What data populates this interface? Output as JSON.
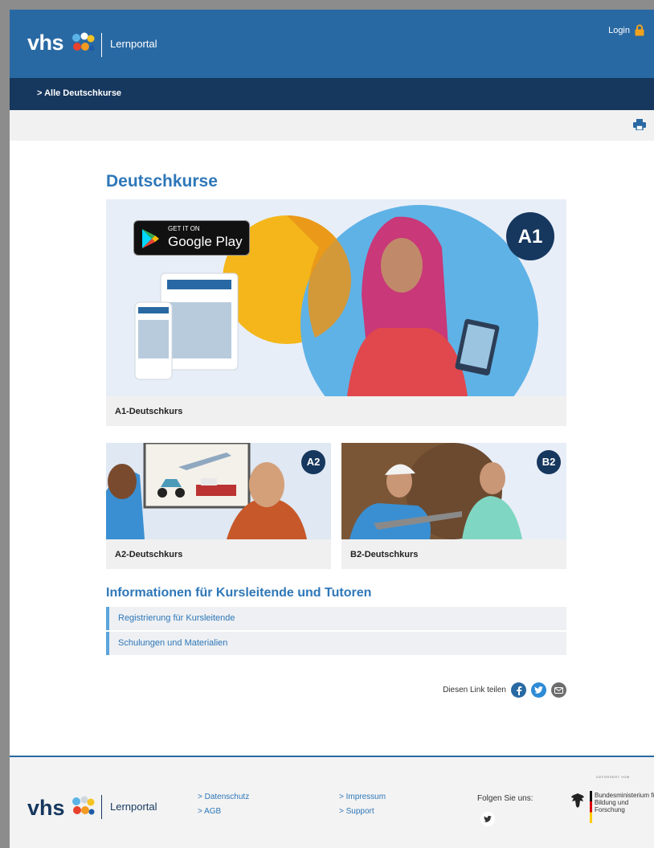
{
  "header": {
    "logo": "vhs",
    "subtitle": "Lernportal",
    "login": "Login"
  },
  "subnav": {
    "link": "> Alle Deutschkurse"
  },
  "main": {
    "title": "Deutschkurse",
    "hero": {
      "badge": "A1",
      "store_top": "GET IT ON",
      "store_main": "Google Play",
      "label": "A1-Deutschkurs"
    },
    "cards": [
      {
        "badge": "A2",
        "label": "A2-Deutschkurs"
      },
      {
        "badge": "B2",
        "label": "B2-Deutschkurs"
      }
    ],
    "info_title": "Informationen für Kursleitende und Tutoren",
    "info_links": [
      "Registrierung für Kursleitende",
      "Schulungen und Materialien"
    ],
    "share_label": "Diesen Link teilen"
  },
  "footer": {
    "logo": "vhs",
    "subtitle": "Lernportal",
    "col1": [
      "> Datenschutz",
      "> AGB"
    ],
    "col2": [
      "> Impressum",
      "> Support"
    ],
    "follow": "Folgen Sie uns:",
    "funded": "GEFÖRDERT VOM",
    "ministry": "Bundesministerium für Bildung und Forschung"
  },
  "colors": {
    "header": "#2969a3",
    "subnav": "#16375e",
    "accent": "#2e77b8",
    "link_bar": "#5ba4db",
    "lock": "#f0a21c"
  }
}
